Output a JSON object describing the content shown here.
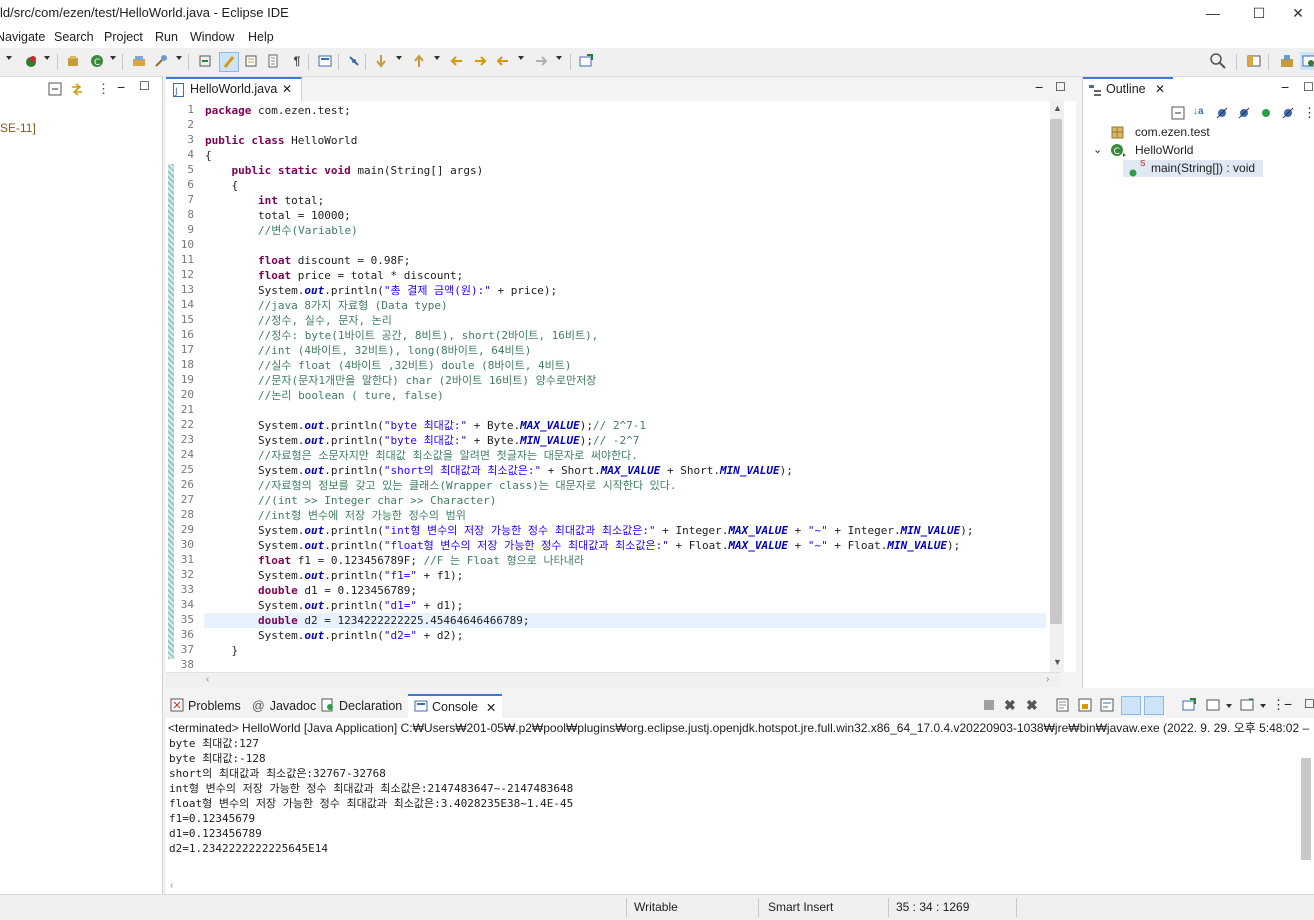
{
  "window": {
    "title": "ld/src/com/ezen/test/HelloWorld.java - Eclipse IDE",
    "minimize": "—",
    "maximize": "☐",
    "close": "✕"
  },
  "menu": [
    "Navigate",
    "Search",
    "Project",
    "Run",
    "Window",
    "Help"
  ],
  "left_panel": {
    "fragment": "SE-11]"
  },
  "editor": {
    "tab_label": "HelloWorld.java",
    "lines": [
      {
        "n": "1",
        "t": "package com.ezen.test;"
      },
      {
        "n": "2",
        "t": ""
      },
      {
        "n": "3",
        "t": "public class HelloWorld"
      },
      {
        "n": "4",
        "t": "{"
      },
      {
        "n": "5",
        "t": "    public static void main(String[] args)"
      },
      {
        "n": "6",
        "t": "    {"
      },
      {
        "n": "7",
        "t": "        int total;"
      },
      {
        "n": "8",
        "t": "        total = 10000;"
      },
      {
        "n": "9",
        "t": "        //변수(Variable)"
      },
      {
        "n": "10",
        "t": ""
      },
      {
        "n": "11",
        "t": "        float discount = 0.98F;"
      },
      {
        "n": "12",
        "t": "        float price = total * discount;"
      },
      {
        "n": "13",
        "t": "        System.out.println(\"총 결제 금액(원):\" + price);"
      },
      {
        "n": "14",
        "t": "        //java 8가지 자료형 (Data type)"
      },
      {
        "n": "15",
        "t": "        //정수, 실수, 문자, 논리"
      },
      {
        "n": "16",
        "t": "        //정수: byte(1바이트 공간, 8비트), short(2바이트, 16비트),"
      },
      {
        "n": "17",
        "t": "        //int (4바이트, 32비트), long(8바이트, 64비트)"
      },
      {
        "n": "18",
        "t": "        //실수 float (4바이트 ,32비트) doule (8바이트, 4비트)"
      },
      {
        "n": "19",
        "t": "        //문자(문자1개만을 말한다) char (2바이트 16비트) 양수로만저장"
      },
      {
        "n": "20",
        "t": "        //논리 boolean ( ture, false)"
      },
      {
        "n": "21",
        "t": ""
      },
      {
        "n": "22",
        "t": "        System.out.println(\"byte 최대값:\" + Byte.MAX_VALUE);// 2^7-1"
      },
      {
        "n": "23",
        "t": "        System.out.println(\"byte 최대값:\" + Byte.MIN_VALUE);// -2^7"
      },
      {
        "n": "24",
        "t": "        //자료형은 소문자지만 최대값 최소값을 알려면 첫글자는 대문자로 써야한다."
      },
      {
        "n": "25",
        "t": "        System.out.println(\"short의 최대값과 최소값은:\" + Short.MAX_VALUE + Short.MIN_VALUE);"
      },
      {
        "n": "26",
        "t": "        //자료형의 정보를 갖고 있는 클래스(Wrapper class)는 대문자로 시작한다 있다."
      },
      {
        "n": "27",
        "t": "        //(int >> Integer char >> Character)"
      },
      {
        "n": "28",
        "t": "        //int형 변수에 저장 가능한 정수의 범위"
      },
      {
        "n": "29",
        "t": "        System.out.println(\"int형 변수의 저장 가능한 정수 최대값과 최소값은:\" + Integer.MAX_VALUE + \"~\" + Integer.MIN_VALUE);"
      },
      {
        "n": "30",
        "t": "        System.out.println(\"float형 변수의 저장 가능한 정수 최대값과 최소값은:\" + Float.MAX_VALUE + \"~\" + Float.MIN_VALUE);"
      },
      {
        "n": "31",
        "t": "        float f1 = 0.123456789F; //F 는 Float 형으로 나타내라"
      },
      {
        "n": "32",
        "t": "        System.out.println(\"f1=\" + f1);"
      },
      {
        "n": "33",
        "t": "        double d1 = 0.123456789;"
      },
      {
        "n": "34",
        "t": "        System.out.println(\"d1=\" + d1);"
      },
      {
        "n": "35",
        "t": "        double d2 = 1234222222225.45464646466789;"
      },
      {
        "n": "36",
        "t": "        System.out.println(\"d2=\" + d2);"
      },
      {
        "n": "37",
        "t": "    }"
      },
      {
        "n": "38",
        "t": ""
      }
    ]
  },
  "outline": {
    "tab_label": "Outline",
    "package": "com.ezen.test",
    "class": "HelloWorld",
    "method": "main(String[]) : void"
  },
  "console": {
    "tabs": [
      "Problems",
      "Javadoc",
      "Declaration",
      "Console"
    ],
    "header": "<terminated> HelloWorld [Java Application] C:₩Users₩201-05₩.p2₩pool₩plugins₩org.eclipse.justj.openjdk.hotspot.jre.full.win32.x86_64_17.0.4.v20220903-1038₩jre₩bin₩javaw.exe  (2022. 9. 29. 오후 5:48:02 –",
    "output": [
      "byte 최대값:127",
      "byte 최대값:-128",
      "short의 최대값과 최소값은:32767-32768",
      "int형 변수의 저장 가능한 정수 최대값과 최소값은:2147483647~-2147483648",
      "float형 변수의 저장 가능한 정수 최대값과 최소값은:3.4028235E38~1.4E-45",
      "f1=0.12345679",
      "d1=0.123456789",
      "d2=1.2342222222225645E14"
    ]
  },
  "status": {
    "writable": "Writable",
    "insert_mode": "Smart Insert",
    "position": "35 : 34 : 1269"
  }
}
